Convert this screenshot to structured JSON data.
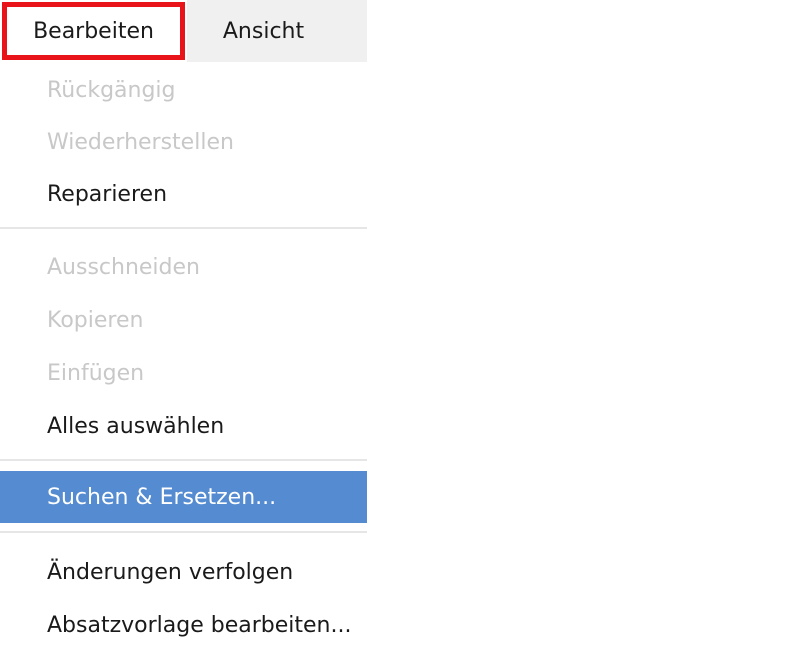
{
  "menubar": {
    "tabs": [
      {
        "label": "Bearbeiten",
        "active": true
      },
      {
        "label": "Ansicht",
        "active": false
      }
    ]
  },
  "menu": {
    "items": [
      {
        "label": "Rückgängig",
        "enabled": false
      },
      {
        "label": "Wiederherstellen",
        "enabled": false
      },
      {
        "label": "Reparieren",
        "enabled": true
      },
      {
        "label": "Ausschneiden",
        "enabled": false
      },
      {
        "label": "Kopieren",
        "enabled": false
      },
      {
        "label": "Einfügen",
        "enabled": false
      },
      {
        "label": "Alles auswählen",
        "enabled": true
      },
      {
        "label": "Suchen & Ersetzen...",
        "enabled": true,
        "selected": true
      },
      {
        "label": "Änderungen verfolgen",
        "enabled": true
      },
      {
        "label": "Absatzvorlage bearbeiten...",
        "enabled": true
      }
    ]
  },
  "colors": {
    "highlight_border": "#e8141a",
    "selection_background": "#558bd0",
    "disabled_text": "#c8c8c8"
  }
}
